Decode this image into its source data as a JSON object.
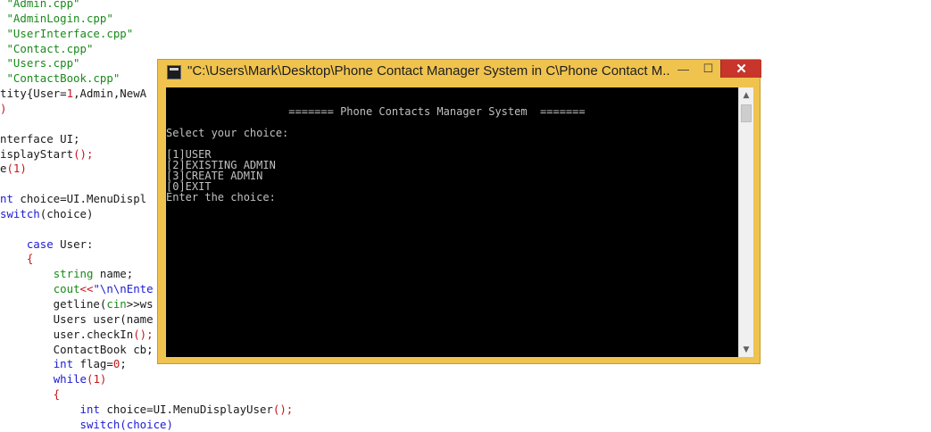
{
  "editor": {
    "lines": [
      {
        "segments": [
          {
            "t": " \"Admin.cpp\"",
            "c": "str"
          }
        ]
      },
      {
        "segments": [
          {
            "t": " \"AdminLogin.cpp\"",
            "c": "str"
          }
        ]
      },
      {
        "segments": [
          {
            "t": " \"UserInterface.cpp\"",
            "c": "str"
          }
        ]
      },
      {
        "segments": [
          {
            "t": " \"Contact.cpp\"",
            "c": "str"
          }
        ]
      },
      {
        "segments": [
          {
            "t": " \"Users.cpp\"",
            "c": "str"
          }
        ]
      },
      {
        "segments": [
          {
            "t": " \"ContactBook.cpp\"",
            "c": "str"
          }
        ]
      },
      {
        "segments": [
          {
            "t": "tity{User=",
            "c": "plain"
          },
          {
            "t": "1",
            "c": "num"
          },
          {
            "t": ",Admin,NewA",
            "c": "plain"
          }
        ]
      },
      {
        "segments": [
          {
            "t": ")",
            "c": "op"
          }
        ]
      },
      {
        "segments": [
          {
            "t": "",
            "c": "plain"
          }
        ]
      },
      {
        "segments": [
          {
            "t": "nterface UI;",
            "c": "plain"
          }
        ]
      },
      {
        "segments": [
          {
            "t": "isplayStart",
            "c": "plain"
          },
          {
            "t": "();",
            "c": "op"
          }
        ]
      },
      {
        "segments": [
          {
            "t": "e",
            "c": "plain"
          },
          {
            "t": "(1)",
            "c": "num"
          }
        ]
      },
      {
        "segments": [
          {
            "t": "",
            "c": "plain"
          }
        ]
      },
      {
        "segments": [
          {
            "t": "nt",
            "c": "kw"
          },
          {
            "t": " choice=UI.MenuDispl",
            "c": "plain"
          }
        ]
      },
      {
        "segments": [
          {
            "t": "switch",
            "c": "kw"
          },
          {
            "t": "(choice)",
            "c": "plain"
          }
        ]
      },
      {
        "segments": [
          {
            "t": "",
            "c": "plain"
          }
        ]
      },
      {
        "segments": [
          {
            "t": "    ",
            "c": "plain"
          },
          {
            "t": "case",
            "c": "kw"
          },
          {
            "t": " User:",
            "c": "plain"
          }
        ]
      },
      {
        "segments": [
          {
            "t": "    {",
            "c": "op"
          }
        ]
      },
      {
        "segments": [
          {
            "t": "        ",
            "c": "plain"
          },
          {
            "t": "string",
            "c": "str"
          },
          {
            "t": " name;",
            "c": "plain"
          }
        ]
      },
      {
        "segments": [
          {
            "t": "        ",
            "c": "plain"
          },
          {
            "t": "cout",
            "c": "str"
          },
          {
            "t": "<<",
            "c": "op"
          },
          {
            "t": "\"\\n\\nEnte",
            "c": "kw"
          }
        ]
      },
      {
        "segments": [
          {
            "t": "        getline(",
            "c": "plain"
          },
          {
            "t": "cin",
            "c": "str"
          },
          {
            "t": ">>ws",
            "c": "plain"
          }
        ]
      },
      {
        "segments": [
          {
            "t": "        Users user(name",
            "c": "plain"
          }
        ]
      },
      {
        "segments": [
          {
            "t": "        user.checkIn",
            "c": "plain"
          },
          {
            "t": "();",
            "c": "op"
          }
        ]
      },
      {
        "segments": [
          {
            "t": "        ContactBook cb;",
            "c": "plain"
          }
        ]
      },
      {
        "segments": [
          {
            "t": "        ",
            "c": "plain"
          },
          {
            "t": "int",
            "c": "kw"
          },
          {
            "t": " flag=",
            "c": "plain"
          },
          {
            "t": "0",
            "c": "num"
          },
          {
            "t": ";",
            "c": "plain"
          }
        ]
      },
      {
        "segments": [
          {
            "t": "        ",
            "c": "plain"
          },
          {
            "t": "while",
            "c": "kw"
          },
          {
            "t": "(1)",
            "c": "num"
          }
        ]
      },
      {
        "segments": [
          {
            "t": "        {",
            "c": "op"
          }
        ]
      },
      {
        "segments": [
          {
            "t": "            ",
            "c": "plain"
          },
          {
            "t": "int",
            "c": "kw"
          },
          {
            "t": " choice=UI.MenuDisplayUser",
            "c": "plain"
          },
          {
            "t": "();",
            "c": "op"
          }
        ]
      },
      {
        "segments": [
          {
            "t": "            switch(choice)",
            "c": "kw"
          }
        ]
      }
    ]
  },
  "window": {
    "title": "\"C:\\Users\\Mark\\Desktop\\Phone Contact Manager System in C\\Phone Contact M...",
    "minimize_label": "—",
    "maximize_label": "☐",
    "close_label": "✕",
    "icon": "console-app-icon"
  },
  "console": {
    "lines": [
      "",
      "                   ======= Phone Contacts Manager System  =======",
      "",
      "Select your choice:",
      "",
      "[1]USER",
      "[2]EXISTING ADMIN",
      "[3]CREATE ADMIN",
      "[0]EXIT",
      "Enter the choice:"
    ]
  },
  "scrollbar": {
    "up_icon": "scroll-up-arrow",
    "down_icon": "scroll-down-arrow"
  },
  "colors": {
    "window_frame": "#f0c34e",
    "close_button": "#c7352b",
    "console_bg": "#000000",
    "console_text": "#c0c0c0",
    "editor_string": "#1a8a1a",
    "editor_keyword": "#1b1bd6",
    "editor_number": "#c4161c"
  }
}
